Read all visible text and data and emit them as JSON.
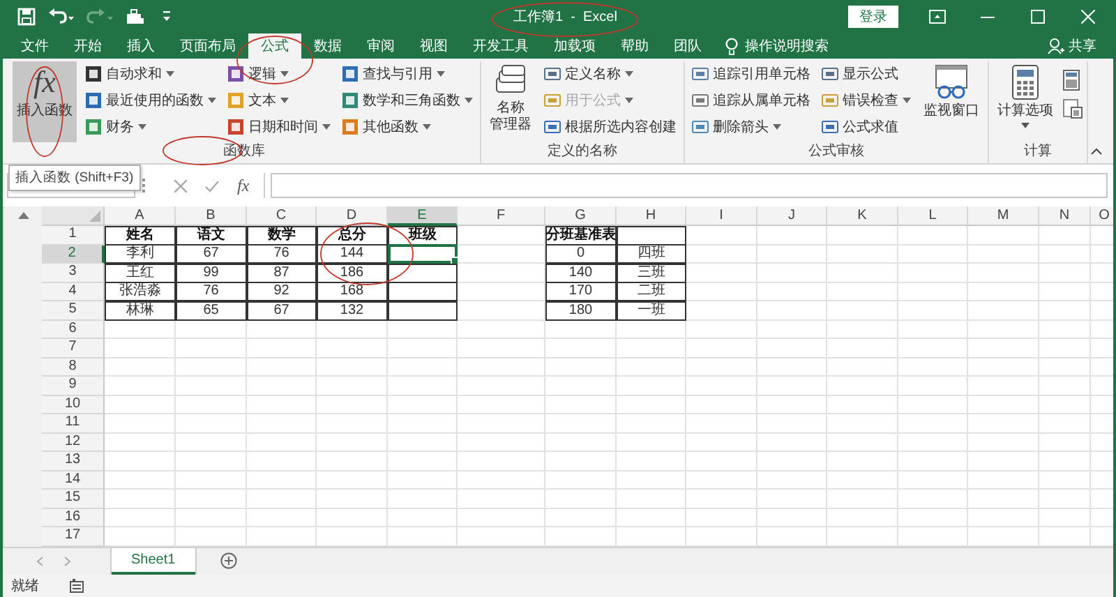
{
  "title_bar": {
    "title": "工作簿1  -  Excel",
    "sign_in": "登录"
  },
  "quick_access": [
    {
      "disabled": false
    },
    {
      "disabled": false
    },
    {
      "disabled": true
    },
    {
      "disabled": false
    },
    {
      "disabled": false
    }
  ],
  "tabs": [
    {
      "label": "文件",
      "selected": false
    },
    {
      "label": "开始",
      "selected": false
    },
    {
      "label": "插入",
      "selected": false
    },
    {
      "label": "页面布局",
      "selected": false
    },
    {
      "label": "公式",
      "selected": true
    },
    {
      "label": "数据",
      "selected": false
    },
    {
      "label": "审阅",
      "selected": false
    },
    {
      "label": "视图",
      "selected": false
    },
    {
      "label": "开发工具",
      "selected": false
    },
    {
      "label": "加载项",
      "selected": false
    },
    {
      "label": "帮助",
      "selected": false
    },
    {
      "label": "团队",
      "selected": false
    }
  ],
  "tell_me": "操作说明搜索",
  "share": "共享",
  "ribbon": {
    "groups": [
      {
        "label": "函数库",
        "columns": [
          {
            "kind": "large",
            "glyph": "fx",
            "label": "插入函数",
            "highlighted": true,
            "dropdown": false
          },
          {
            "kind": "stack",
            "items": [
              {
                "label": "自动求和",
                "dropdown": true,
                "disabled": false
              },
              {
                "label": "最近使用的函数",
                "dropdown": true,
                "disabled": false
              },
              {
                "label": "财务",
                "dropdown": true,
                "disabled": false
              }
            ]
          },
          {
            "kind": "stack",
            "items": [
              {
                "label": "逻辑",
                "dropdown": true,
                "disabled": false
              },
              {
                "label": "文本",
                "dropdown": true,
                "disabled": false
              },
              {
                "label": "日期和时间",
                "dropdown": true,
                "disabled": false
              }
            ]
          },
          {
            "kind": "stack",
            "items": [
              {
                "label": "查找与引用",
                "dropdown": true,
                "disabled": false
              },
              {
                "label": "数学和三角函数",
                "dropdown": true,
                "disabled": false
              },
              {
                "label": "其他函数",
                "dropdown": true,
                "disabled": false
              }
            ]
          }
        ]
      },
      {
        "label": "定义的名称",
        "columns": [
          {
            "kind": "large",
            "lines": [
              "名称",
              "管理器"
            ],
            "highlighted": false,
            "dropdown": false
          },
          {
            "kind": "stack",
            "items": [
              {
                "label": "定义名称",
                "dropdown": true,
                "disabled": false
              },
              {
                "label": "用于公式",
                "dropdown": true,
                "disabled": true
              },
              {
                "label": "根据所选内容创建",
                "dropdown": false,
                "disabled": false
              }
            ]
          }
        ]
      },
      {
        "label": "公式审核",
        "columns": [
          {
            "kind": "stack",
            "items": [
              {
                "label": "追踪引用单元格",
                "dropdown": false,
                "disabled": false
              },
              {
                "label": "追踪从属单元格",
                "dropdown": false,
                "disabled": false
              },
              {
                "label": "删除箭头",
                "dropdown": true,
                "disabled": false
              }
            ]
          },
          {
            "kind": "stack",
            "items": [
              {
                "label": "显示公式",
                "dropdown": false,
                "disabled": false
              },
              {
                "label": "错误检查",
                "dropdown": true,
                "disabled": false
              },
              {
                "label": "公式求值",
                "dropdown": false,
                "disabled": false
              }
            ]
          },
          {
            "kind": "large",
            "label": "监视窗口",
            "highlighted": false,
            "dropdown": false
          }
        ]
      },
      {
        "label": "计算",
        "columns": [
          {
            "kind": "large",
            "label": "计算选项",
            "highlighted": false,
            "dropdown": true
          },
          {
            "kind": "icons"
          }
        ]
      }
    ]
  },
  "formula_bar": {
    "tooltip": "插入函数 (Shift+F3)",
    "function_glyph": "fx"
  },
  "grid": {
    "columns": [
      "A",
      "B",
      "C",
      "D",
      "E",
      "F",
      "G",
      "H",
      "I",
      "J",
      "K",
      "L",
      "M",
      "N",
      "O"
    ],
    "rows": [
      {
        "number": "1",
        "cells": [
          {
            "text": "姓名",
            "bold": true,
            "bordered": true,
            "selected": false
          },
          {
            "text": "语文",
            "bold": true,
            "bordered": true,
            "selected": false
          },
          {
            "text": "数学",
            "bold": true,
            "bordered": true,
            "selected": false
          },
          {
            "text": "总分",
            "bold": true,
            "bordered": true,
            "selected": false
          },
          {
            "text": "班级",
            "bold": true,
            "bordered": true,
            "selected": false
          },
          {
            "bordered": false,
            "selected": false
          },
          {
            "text": "分班基准表",
            "bold": true,
            "bordered": true,
            "selected": false
          },
          {
            "bordered": true,
            "selected": false
          }
        ]
      },
      {
        "number": "2",
        "cells": [
          {
            "text": "李利",
            "bordered": true,
            "selected": false
          },
          {
            "text": "67",
            "bordered": true,
            "selected": false
          },
          {
            "text": "76",
            "bordered": true,
            "selected": false
          },
          {
            "text": "144",
            "bordered": true,
            "selected": false
          },
          {
            "bordered": true,
            "selected": true
          },
          {
            "bordered": false,
            "selected": false
          },
          {
            "text": "0",
            "bordered": true,
            "selected": false
          },
          {
            "text": "四班",
            "bordered": true,
            "selected": false
          }
        ]
      },
      {
        "number": "3",
        "cells": [
          {
            "text": "王红",
            "bordered": true,
            "selected": false
          },
          {
            "text": "99",
            "bordered": true,
            "selected": false
          },
          {
            "text": "87",
            "bordered": true,
            "selected": false
          },
          {
            "text": "186",
            "bordered": true,
            "selected": false
          },
          {
            "bordered": true,
            "selected": false
          },
          {
            "bordered": false,
            "selected": false
          },
          {
            "text": "140",
            "bordered": true,
            "selected": false
          },
          {
            "text": "三班",
            "bordered": true,
            "selected": false
          }
        ]
      },
      {
        "number": "4",
        "cells": [
          {
            "text": "张浩淼",
            "bordered": true,
            "selected": false
          },
          {
            "text": "76",
            "bordered": true,
            "selected": false
          },
          {
            "text": "92",
            "bordered": true,
            "selected": false
          },
          {
            "text": "168",
            "bordered": true,
            "selected": false
          },
          {
            "bordered": true,
            "selected": false
          },
          {
            "bordered": false,
            "selected": false
          },
          {
            "text": "170",
            "bordered": true,
            "selected": false
          },
          {
            "text": "二班",
            "bordered": true,
            "selected": false
          }
        ]
      },
      {
        "number": "5",
        "cells": [
          {
            "text": "林琳",
            "bordered": true,
            "selected": false
          },
          {
            "text": "65",
            "bordered": true,
            "selected": false
          },
          {
            "text": "67",
            "bordered": true,
            "selected": false
          },
          {
            "text": "132",
            "bordered": true,
            "selected": false
          },
          {
            "bordered": true,
            "selected": false
          },
          {
            "bordered": false,
            "selected": false
          },
          {
            "text": "180",
            "bordered": true,
            "selected": false
          },
          {
            "text": "一班",
            "bordered": true,
            "selected": false
          }
        ]
      },
      {
        "number": "6"
      },
      {
        "number": "7"
      },
      {
        "number": "8"
      },
      {
        "number": "9"
      },
      {
        "number": "10"
      },
      {
        "number": "11"
      },
      {
        "number": "12"
      },
      {
        "number": "13"
      },
      {
        "number": "14"
      },
      {
        "number": "15"
      },
      {
        "number": "16"
      },
      {
        "number": "17"
      }
    ]
  },
  "sheet_tabs": [
    {
      "label": "Sheet1",
      "selected": true
    }
  ],
  "status_bar": {
    "status": "就绪"
  }
}
